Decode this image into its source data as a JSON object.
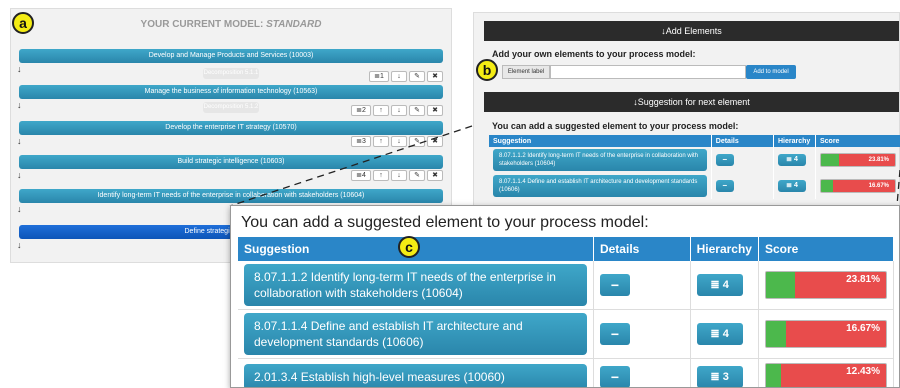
{
  "callouts": {
    "a": "a",
    "b": "b",
    "c": "c"
  },
  "left": {
    "title_prefix": "YOUR CURRENT MODEL: ",
    "title_model": "STANDARD",
    "elements": [
      {
        "label": "Develop and Manage Products and Services (10003)",
        "pill": "Decomposition 5.1.1",
        "level": "1"
      },
      {
        "label": "Manage the business of information technology (10563)",
        "pill": "Decomposition 5.1.2",
        "level": "2"
      },
      {
        "label": "Develop the enterprise IT strategy (10570)",
        "pill": "",
        "level": "3"
      },
      {
        "label": "Build strategic intelligence (10603)",
        "pill": "",
        "level": "4"
      },
      {
        "label": "Identify long-term IT needs of the enterprise in collaboration with stakeholders (10604)",
        "pill": "",
        "level": ""
      },
      {
        "label": "Define strategic standards, gu",
        "pill": "",
        "level": ""
      }
    ],
    "icons": {
      "up": "↑",
      "down": "↓",
      "edit": "✎",
      "delete": "✖",
      "hierarchy": "≣"
    }
  },
  "right": {
    "add_header": "Add Elements",
    "add_title": "Add your own elements to your process model:",
    "element_label": "Element label",
    "input_value": "",
    "add_button": "Add to model",
    "sugg_header": "Suggestion for next element",
    "sugg_title": "You can add a suggested element to your process model:",
    "columns": [
      "Suggestion",
      "Details",
      "Hierarchy",
      "Score"
    ],
    "rows": [
      {
        "text": "8.07.1.1.2 Identify long-term IT needs of the enterprise in collaboration with stakeholders (10604)",
        "level": "4",
        "score": "23.81%",
        "fraction": 0.2381
      },
      {
        "text": "8.07.1.1.4 Define and establish IT architecture and development standards (10606)",
        "level": "4",
        "score": "16.67%",
        "fraction": 0.1667
      }
    ]
  },
  "zoom": {
    "title": "You can add a suggested element to your process model:",
    "columns": [
      "Suggestion",
      "Details",
      "Hierarchy",
      "Score"
    ],
    "rows": [
      {
        "text": "8.07.1.1.2 Identify long-term IT needs of the enterprise in collaboration with stakeholders (10604)",
        "level": "4",
        "score": "23.81%",
        "fraction": 0.2381
      },
      {
        "text": "8.07.1.1.4 Define and establish IT architecture and development standards (10606)",
        "level": "4",
        "score": "16.67%",
        "fraction": 0.1667
      },
      {
        "text": "2.01.3.4 Establish high-level measures (10060)",
        "level": "3",
        "score": "12.43%",
        "fraction": 0.1243
      }
    ]
  },
  "colors": {
    "accent": "#2a86c8",
    "score_red": "#e84c4c",
    "score_green": "#4cb84c",
    "callout": "#f4ec14"
  }
}
